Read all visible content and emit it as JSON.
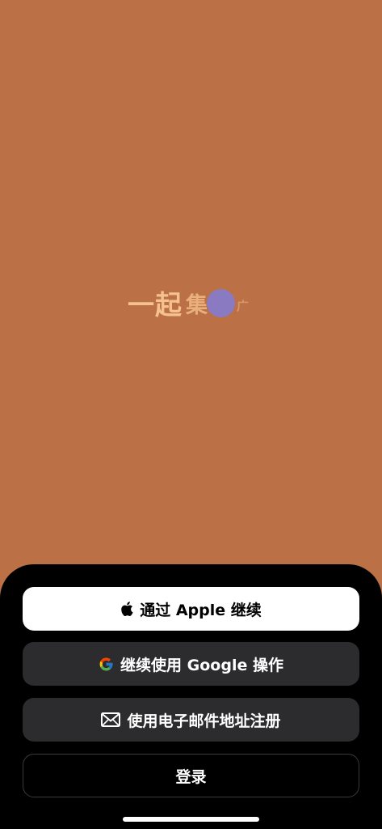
{
  "splash": {
    "headline_part1": "一起",
    "headline_part2": "集",
    "headline_tail": "广"
  },
  "auth": {
    "apple_label": "通过 Apple 继续",
    "google_label": "继续使用 Google 操作",
    "email_label": "使用电子邮件地址注册",
    "login_label": "登录"
  },
  "icons": {
    "apple": "apple-icon",
    "google": "google-icon",
    "email": "mail-icon"
  },
  "colors": {
    "background": "#BB7046",
    "accent_dot": "#8A7AC2",
    "sheet": "#000000",
    "secondary_button": "#2C2C2E"
  }
}
